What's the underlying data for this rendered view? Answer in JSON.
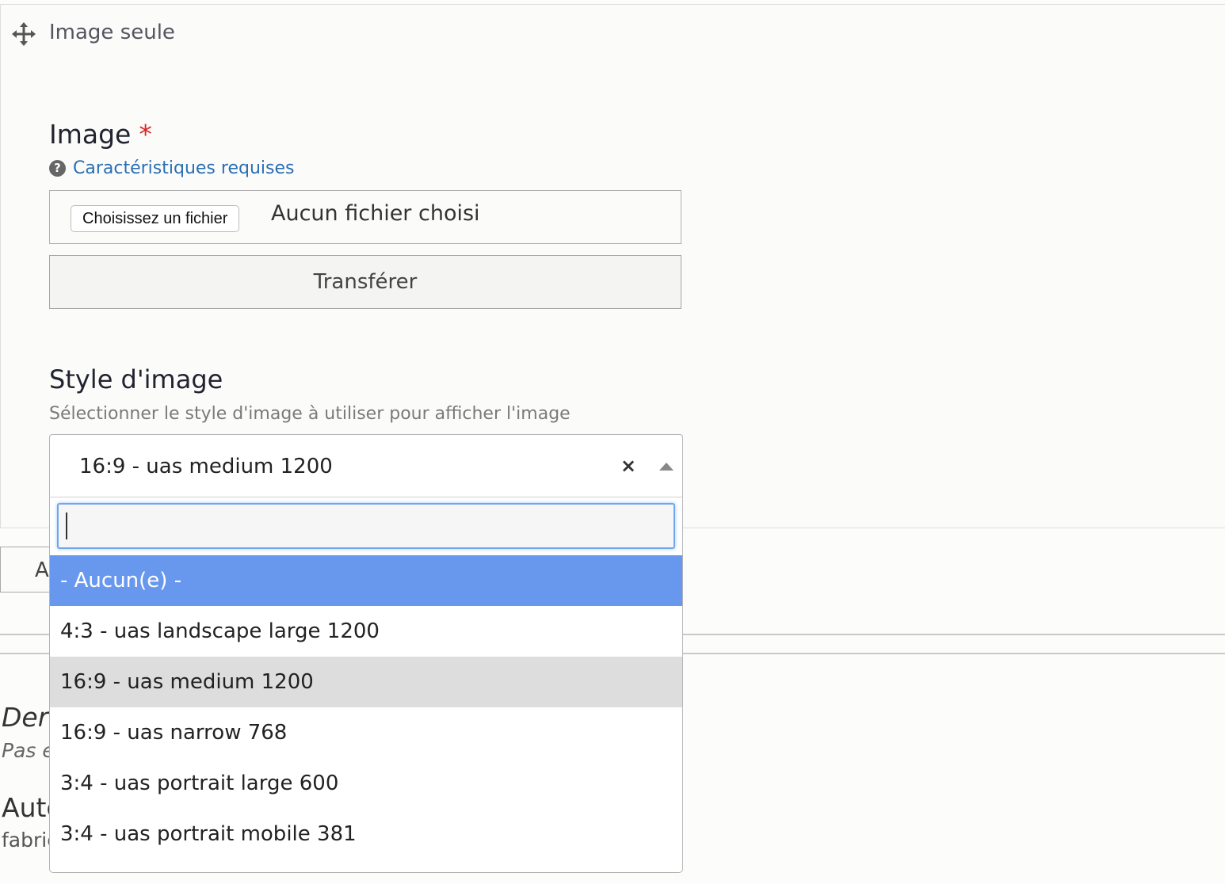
{
  "panel": {
    "title": "Image seule"
  },
  "image_field": {
    "label": "Image",
    "required_mark": "*",
    "help_link": "Caractéristiques requises",
    "help_icon_glyph": "?",
    "choose_file_label": "Choisissez un fichier",
    "no_file_text": "Aucun fichier choisi",
    "upload_label": "Transférer"
  },
  "image_style": {
    "label": "Style d'image",
    "description": "Sélectionner le style d'image à utiliser pour afficher l'image",
    "selected_value": "16:9 - uas medium 1200",
    "clear_glyph": "×",
    "search_value": "",
    "options": [
      {
        "label": "- Aucun(e) -",
        "state": "highlighted"
      },
      {
        "label": "4:3 - uas landscape large 1200",
        "state": ""
      },
      {
        "label": "16:9 - uas medium 1200",
        "state": "selected"
      },
      {
        "label": "16:9 - uas narrow 768",
        "state": ""
      },
      {
        "label": "3:4 - uas portrait large 600",
        "state": ""
      },
      {
        "label": "3:4 - uas portrait mobile 381",
        "state": ""
      }
    ]
  },
  "background": {
    "button_partial": "A",
    "der_partial": "Der",
    "pas_partial": "Pas e",
    "aut_partial": "Aute",
    "fab_partial": "fabric"
  },
  "colors": {
    "link": "#2a6fb4",
    "required": "#dc2323",
    "highlight": "#6898ee",
    "selected": "#dddddd",
    "focus_border": "#6fa7ee"
  }
}
